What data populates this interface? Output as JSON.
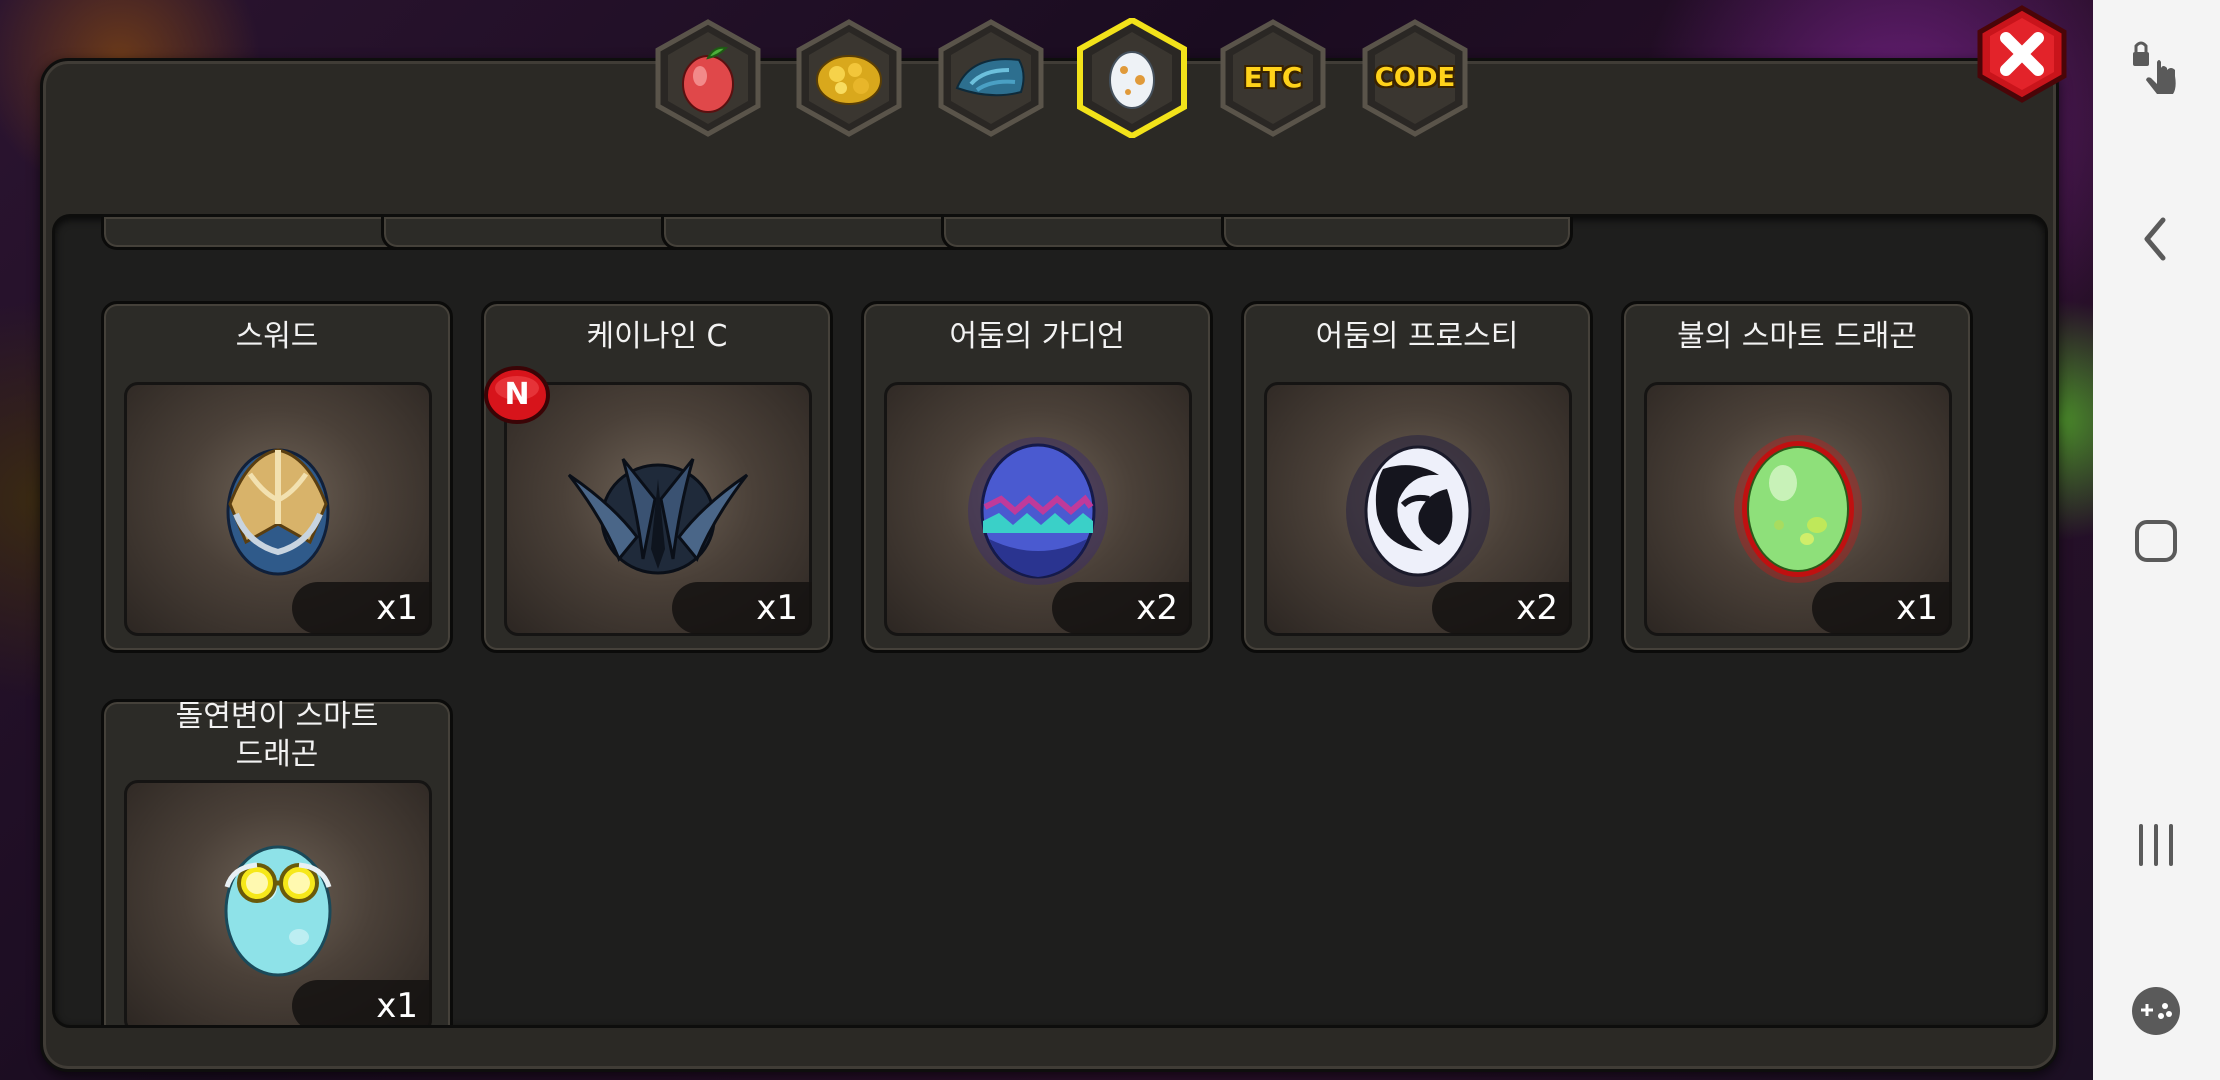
{
  "tabs": [
    {
      "id": "fruit",
      "icon": "red-fruit-icon"
    },
    {
      "id": "gold",
      "icon": "gold-ore-icon"
    },
    {
      "id": "scale",
      "icon": "dragon-scale-icon"
    },
    {
      "id": "egg",
      "icon": "egg-icon",
      "selected": true
    },
    {
      "id": "etc",
      "label": "ETC"
    },
    {
      "id": "code",
      "label": "CODE"
    }
  ],
  "items": [
    {
      "name": "스워드",
      "qty": "x1",
      "icon": "sword-egg-icon"
    },
    {
      "name": "케이나인 C",
      "qty": "x1",
      "icon": "canine-c-egg-icon",
      "badge": "N"
    },
    {
      "name": "어둠의 가디언",
      "qty": "x2",
      "icon": "dark-guardian-egg-icon"
    },
    {
      "name": "어둠의 프로스티",
      "qty": "x2",
      "icon": "dark-frosty-egg-icon"
    },
    {
      "name": "불의 스마트 드래곤",
      "qty": "x1",
      "icon": "fire-smart-dragon-egg-icon"
    },
    {
      "name": "돌연변이 스마트 드래곤",
      "name_lines": [
        "돌연변이 스마트",
        "드래곤"
      ],
      "qty": "x1",
      "icon": "mutant-smart-dragon-egg-icon"
    }
  ],
  "colors": {
    "tab_text": "#ffd21a",
    "selected_tab_ring": "#f2e21a",
    "close_button": "#d7141b",
    "new_badge": "#d7141b"
  }
}
